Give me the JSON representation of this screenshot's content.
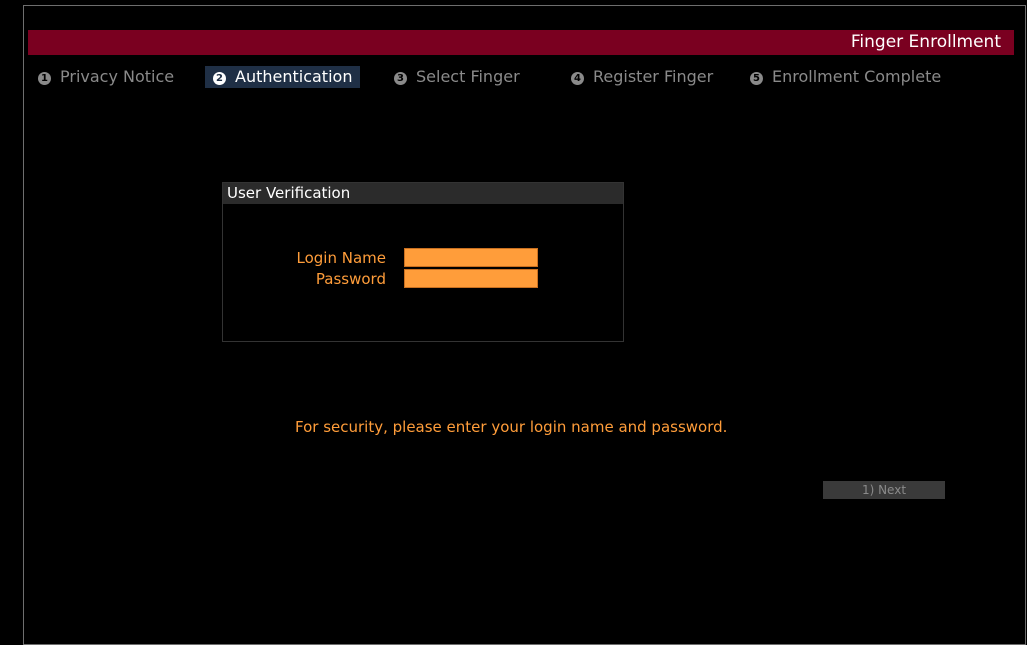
{
  "header": {
    "title": "Finger Enrollment"
  },
  "steps": [
    {
      "number": "1",
      "label": "Privacy Notice",
      "active": false
    },
    {
      "number": "2",
      "label": "Authentication",
      "active": true
    },
    {
      "number": "3",
      "label": "Select Finger",
      "active": false
    },
    {
      "number": "4",
      "label": "Register Finger",
      "active": false
    },
    {
      "number": "5",
      "label": "Enrollment Complete",
      "active": false
    }
  ],
  "verification": {
    "title": "User Verification",
    "login_label": "Login Name",
    "login_value": "",
    "password_label": "Password",
    "password_value": ""
  },
  "message": "For security, please enter your login name and password.",
  "next_button": "1) Next",
  "colors": {
    "title_bar": "#7a0020",
    "accent_orange": "#ff9d3a",
    "active_step_bg": "#1f2f45",
    "background": "#000000"
  }
}
